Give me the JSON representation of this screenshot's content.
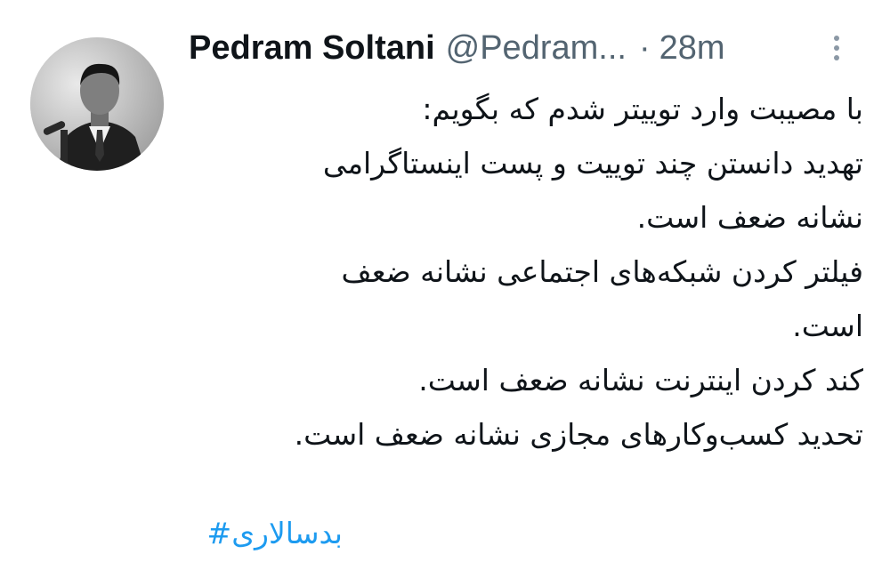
{
  "author": {
    "display_name": "Pedram Soltani",
    "handle": "@Pedram...",
    "separator": "·",
    "time": "28m",
    "avatar_icon": "profile-photo"
  },
  "tweet": {
    "lines": [
      "با مصیبت وارد توییتر شدم که بگویم:",
      "تهدید دانستن چند توییت و پست اینستاگرامی",
      "نشانه ضعف است.",
      "فیلتر کردن شبکه‌های اجتماعی نشانه ضعف",
      "است.",
      "کند کردن اینترنت نشانه ضعف است.",
      "تحدید کسب‌وکارهای مجازی نشانه ضعف است."
    ],
    "hashtag": "بدسالاری#"
  },
  "colors": {
    "text": "#0f1419",
    "secondary": "#536471",
    "link": "#1d9bf0"
  },
  "icons": {
    "more": "more-vertical-icon"
  }
}
